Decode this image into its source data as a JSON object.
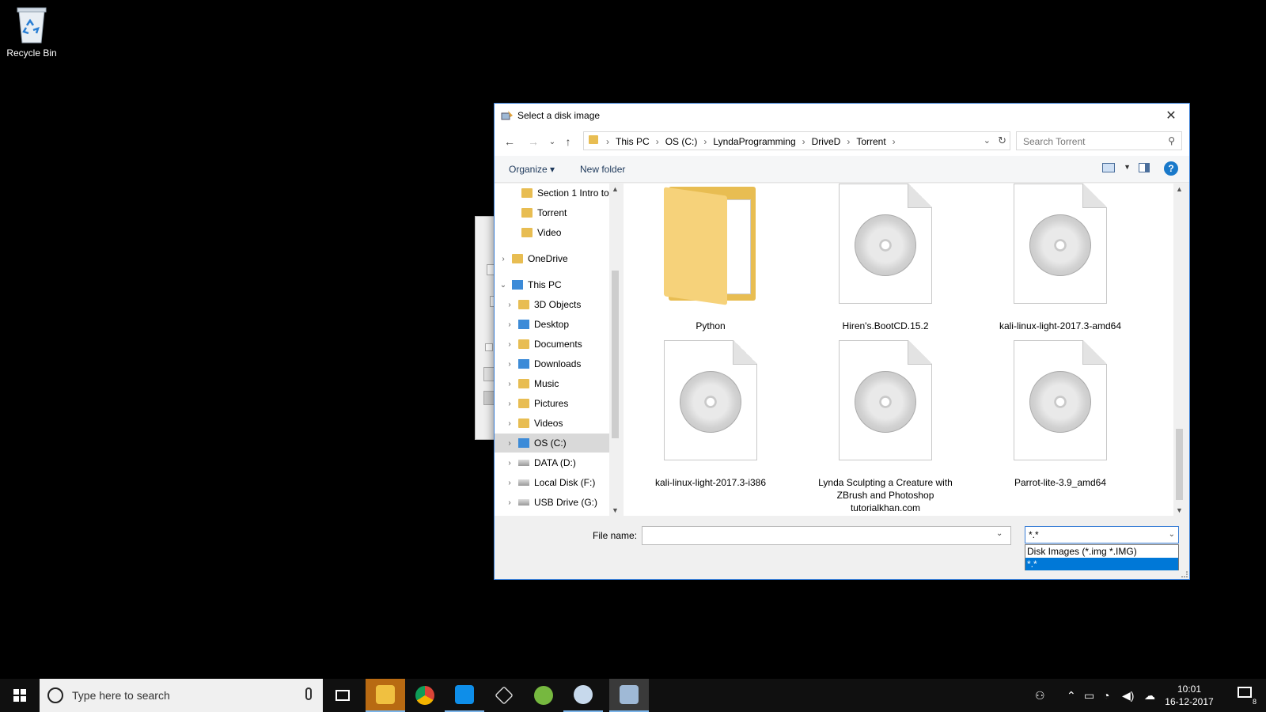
{
  "desktop": {
    "icons": [
      {
        "label": "Recycle Bin",
        "icon": "recycle-bin-icon"
      }
    ]
  },
  "dialog": {
    "title": "Select a disk image",
    "close_glyph": "✕",
    "breadcrumb": [
      "This PC",
      "OS (C:)",
      "LyndaProgramming",
      "DriveD",
      "Torrent"
    ],
    "search_placeholder": "Search Torrent",
    "toolbar": {
      "organize": "Organize ▾",
      "new_folder": "New folder",
      "help": "?"
    },
    "tree": [
      {
        "label": "Section 1 Intro to",
        "icon": "folder-icon",
        "expand": ""
      },
      {
        "label": "Torrent",
        "icon": "folder-icon",
        "expand": ""
      },
      {
        "label": "Video",
        "icon": "folder-icon",
        "expand": ""
      },
      {
        "label": "OneDrive",
        "icon": "onedrive-folder-icon",
        "expand": "›"
      },
      {
        "label": "This PC",
        "icon": "computer-icon",
        "expand": "⌄"
      },
      {
        "label": "3D Objects",
        "icon": "3d-objects-icon",
        "expand": "›"
      },
      {
        "label": "Desktop",
        "icon": "desktop-folder-icon",
        "expand": "›"
      },
      {
        "label": "Documents",
        "icon": "documents-icon",
        "expand": "›"
      },
      {
        "label": "Downloads",
        "icon": "downloads-icon",
        "expand": "›"
      },
      {
        "label": "Music",
        "icon": "music-icon",
        "expand": "›"
      },
      {
        "label": "Pictures",
        "icon": "pictures-icon",
        "expand": "›"
      },
      {
        "label": "Videos",
        "icon": "videos-icon",
        "expand": "›"
      },
      {
        "label": "OS (C:)",
        "icon": "windows-drive-icon",
        "expand": "›",
        "selected": true
      },
      {
        "label": "DATA (D:)",
        "icon": "drive-icon",
        "expand": "›"
      },
      {
        "label": "Local Disk (F:)",
        "icon": "drive-icon",
        "expand": "›"
      },
      {
        "label": "USB Drive (G:)",
        "icon": "drive-icon",
        "expand": "›"
      }
    ],
    "files": [
      {
        "name": "Python",
        "kind": "folder"
      },
      {
        "name": "Hiren's.BootCD.15.2",
        "kind": "disk-image"
      },
      {
        "name": "kali-linux-light-2017.3-amd64",
        "kind": "disk-image"
      },
      {
        "name": "kali-linux-light-2017.3-i386",
        "kind": "disk-image"
      },
      {
        "name": "Lynda Sculpting a Creature with ZBrush and Photoshop tutorialkhan.com",
        "kind": "disk-image"
      },
      {
        "name": "Parrot-lite-3.9_amd64",
        "kind": "disk-image"
      }
    ],
    "file_name_label": "File name:",
    "file_name_value": "",
    "filter": {
      "selected": "*.*",
      "options": [
        "Disk Images (*.img *.IMG)",
        "*.*"
      ]
    }
  },
  "taskbar": {
    "search_placeholder": "Type here to search",
    "apps": [
      {
        "name": "task-view-icon",
        "open": false
      },
      {
        "name": "file-explorer-icon",
        "open": true,
        "active": true,
        "color": "#f0b400"
      },
      {
        "name": "chrome-icon",
        "open": false,
        "color": "#4285f4"
      },
      {
        "name": "teamviewer-icon",
        "open": true,
        "color": "#0e8ee9"
      },
      {
        "name": "unity-icon",
        "open": false,
        "color": "#dddddd"
      },
      {
        "name": "utorrent-icon",
        "open": false,
        "color": "#76b83f"
      },
      {
        "name": "paint-icon",
        "open": true,
        "color": "#c7d9ec"
      },
      {
        "name": "disk-imager-icon",
        "open": true,
        "active": true,
        "color": "#9fb9d6"
      }
    ],
    "time": "10:01",
    "date": "16-12-2017",
    "notifications": "8"
  }
}
